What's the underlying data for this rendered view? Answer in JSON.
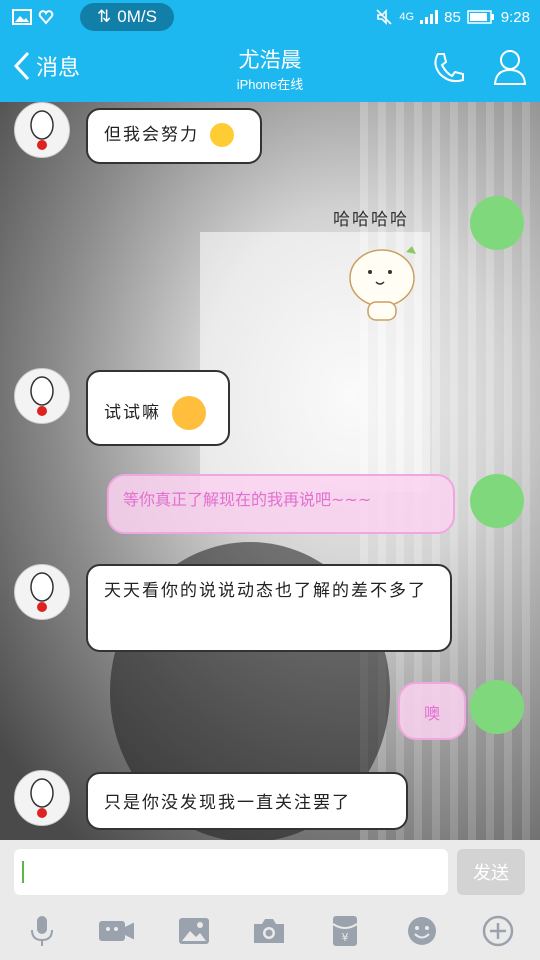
{
  "status_bar": {
    "speed": "0M/S",
    "network": "4G",
    "battery": "85",
    "time": "9:28"
  },
  "header": {
    "back_label": "消息",
    "title": "尤浩晨",
    "subtitle": "iPhone在线",
    "accent_color": "#1eb8f0"
  },
  "messages": [
    {
      "side": "left",
      "text": "但我会努力"
    },
    {
      "side": "right",
      "text": "哈哈哈哈"
    },
    {
      "side": "left",
      "text": "试试嘛"
    },
    {
      "side": "right",
      "text": "等你真正了解现在的我再说吧~~~"
    },
    {
      "side": "left",
      "text": "天天看你的说说动态也了解的差不多了"
    },
    {
      "side": "right",
      "text": "噢"
    },
    {
      "side": "left",
      "text": "只是你没发现我一直关注罢了"
    }
  ],
  "input": {
    "value": "",
    "send_label": "发送"
  },
  "toolbar": {
    "icons": [
      "microphone-icon",
      "video-icon",
      "image-icon",
      "camera-icon",
      "red-packet-icon",
      "emoji-icon",
      "plus-icon"
    ]
  }
}
